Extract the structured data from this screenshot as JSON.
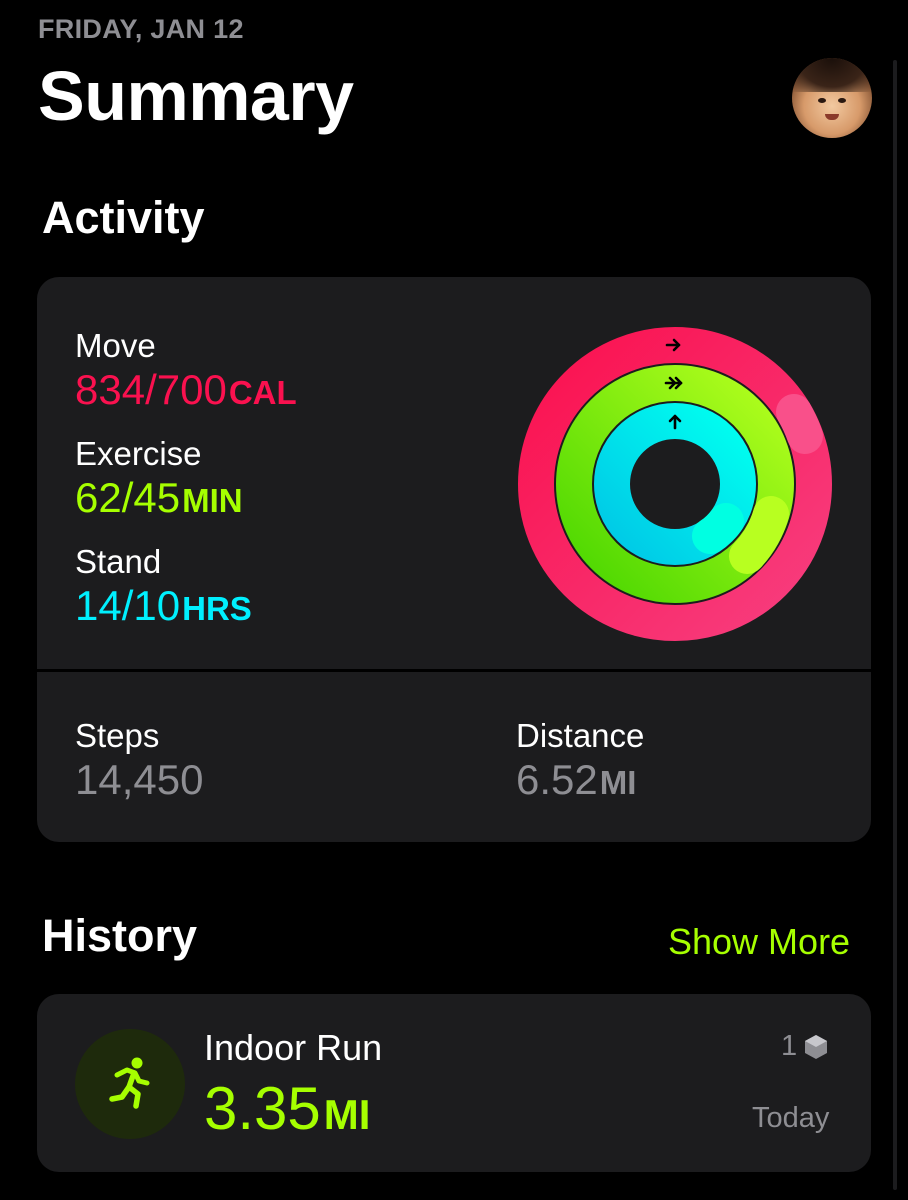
{
  "header": {
    "date": "FRIDAY, JAN 12",
    "title": "Summary"
  },
  "activity": {
    "heading": "Activity",
    "move": {
      "label": "Move",
      "value": "834/700",
      "unit": "CAL",
      "current": 834,
      "goal": 700,
      "color": "#fa114f"
    },
    "exercise": {
      "label": "Exercise",
      "value": "62/45",
      "unit": "MIN",
      "current": 62,
      "goal": 45,
      "color": "#a6ff00"
    },
    "stand": {
      "label": "Stand",
      "value": "14/10",
      "unit": "HRS",
      "current": 14,
      "goal": 10,
      "color": "#00f0ff"
    },
    "steps": {
      "label": "Steps",
      "value": "14,450"
    },
    "distance": {
      "label": "Distance",
      "value": "6.52",
      "unit": "MI"
    }
  },
  "history": {
    "heading": "History",
    "show_more": "Show More",
    "workout": {
      "icon": "running-figure-icon",
      "name": "Indoor Run",
      "distance": "3.35",
      "unit": "MI",
      "count": "1",
      "date": "Today"
    }
  },
  "colors": {
    "accent": "#a6ff00",
    "background": "#000000",
    "card": "#1c1c1e"
  }
}
